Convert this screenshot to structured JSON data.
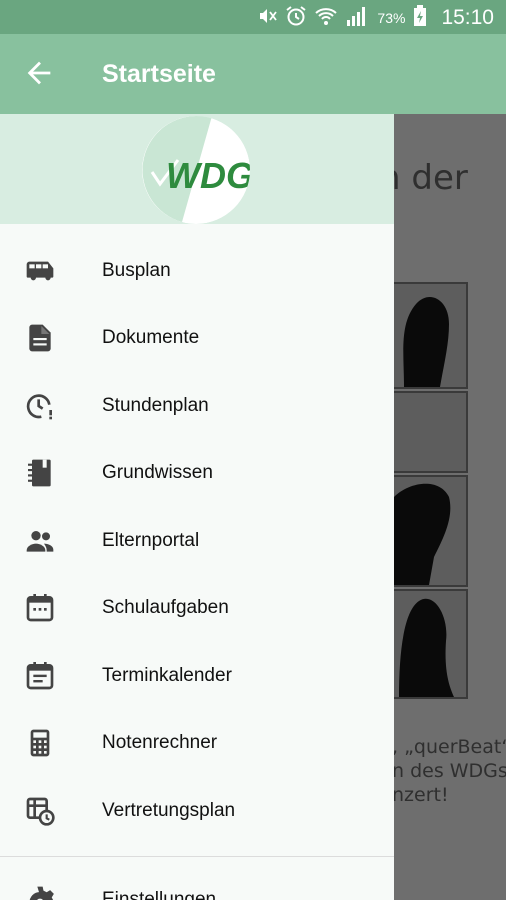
{
  "status_bar": {
    "battery": "73%",
    "time": "15:10",
    "icons": [
      "mute-icon",
      "alarm-icon",
      "wifi-icon",
      "signal-icon",
      "battery-icon"
    ]
  },
  "app_bar": {
    "title": "Startseite",
    "back_icon": "arrow-back-icon"
  },
  "drawer": {
    "logo_text": "WDG",
    "items": [
      {
        "label": "Busplan",
        "icon": "bus-icon"
      },
      {
        "label": "Dokumente",
        "icon": "document-icon"
      },
      {
        "label": "Stundenplan",
        "icon": "clock-icon"
      },
      {
        "label": "Grundwissen",
        "icon": "notebook-icon"
      },
      {
        "label": "Elternportal",
        "icon": "people-icon"
      },
      {
        "label": "Schulaufgaben",
        "icon": "calendar-icon"
      },
      {
        "label": "Terminkalender",
        "icon": "event-icon"
      },
      {
        "label": "Notenrechner",
        "icon": "calculator-icon"
      },
      {
        "label": "Vertretungsplan",
        "icon": "schedule-icon"
      },
      {
        "label": "Einstellungen",
        "icon": "gear-icon"
      }
    ]
  },
  "background": {
    "heading_fragment": "n der",
    "caption_lines": [
      ", „querBeat“.",
      "n des WDGs",
      "nzert!"
    ]
  },
  "colors": {
    "status_bar": "#6aa680",
    "app_bar": "#88c19e",
    "drawer_header": "#d8ede1",
    "logo_green": "#2e8b3e"
  }
}
